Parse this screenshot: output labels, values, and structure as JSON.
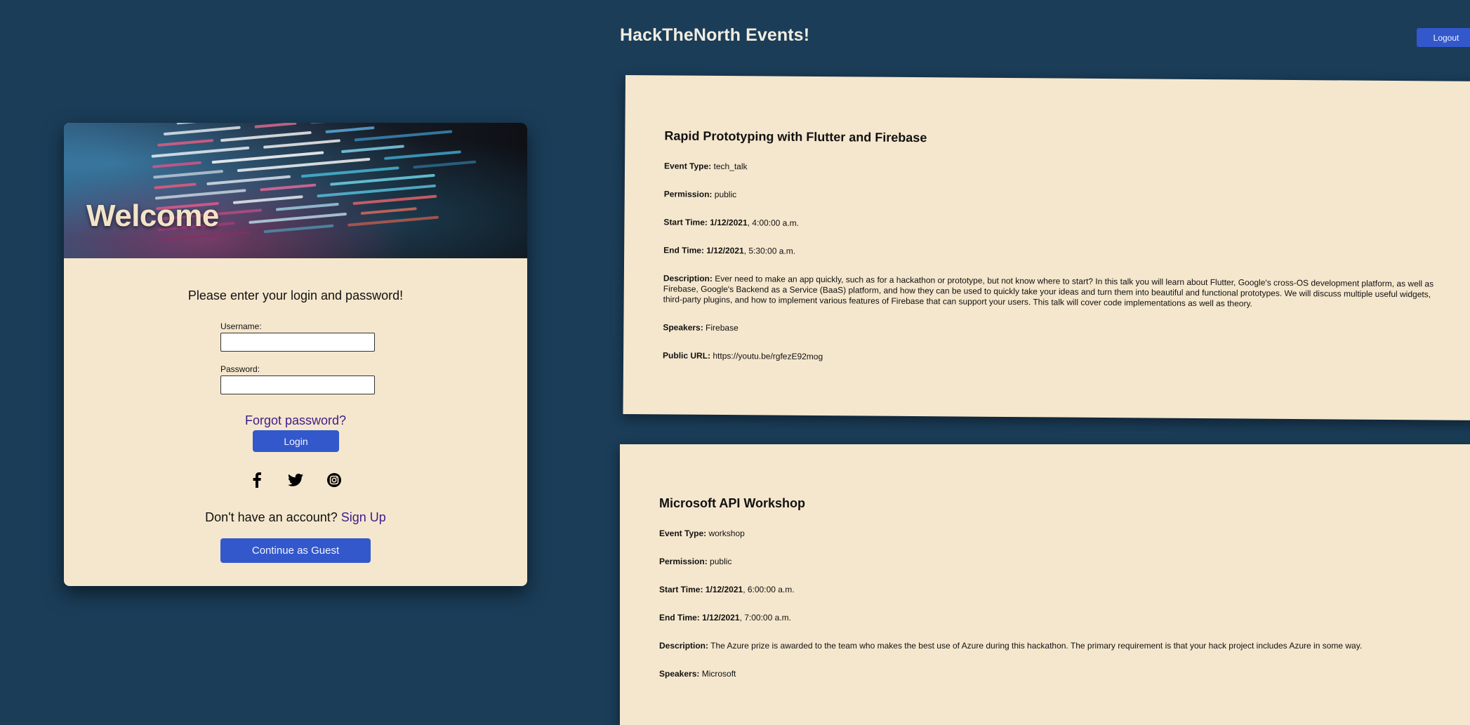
{
  "header": {
    "title": "HackTheNorth Events!",
    "logout_label": "Logout"
  },
  "login": {
    "welcome": "Welcome",
    "prompt": "Please enter your login and password!",
    "username_label": "Username:",
    "username_value": "",
    "password_label": "Password:",
    "password_value": "",
    "forgot_label": "Forgot password?",
    "login_label": "Login",
    "social": [
      "facebook-icon",
      "twitter-icon",
      "instagram-icon"
    ],
    "signup_prompt": "Don't have an account?",
    "signup_label": "Sign Up",
    "guest_label": "Continue as Guest"
  },
  "labels": {
    "event_type": "Event Type:",
    "permission": "Permission:",
    "start_time": "Start Time:",
    "end_time": "End Time:",
    "description": "Description:",
    "speakers": "Speakers:",
    "public_url": "Public URL:"
  },
  "events": [
    {
      "name": "Rapid Prototyping with Flutter and Firebase",
      "event_type": "tech_talk",
      "permission": "public",
      "start_date": "1/12/2021",
      "start_time": "4:00:00 a.m.",
      "end_date": "1/12/2021",
      "end_time": "5:30:00 a.m.",
      "description": "Ever need to make an app quickly, such as for a hackathon or prototype, but not know where to start? In this talk you will learn about Flutter, Google's cross-OS development platform, as well as Firebase, Google's Backend as a Service (BaaS) platform, and how they can be used to quickly take your ideas and turn them into beautiful and functional prototypes. We will discuss multiple useful widgets, third-party plugins, and how to implement various features of Firebase that can support your users. This talk will cover code implementations as well as theory.",
      "speakers": "Firebase",
      "public_url": "https://youtu.be/rgfezE92mog"
    },
    {
      "name": "Microsoft API Workshop",
      "event_type": "workshop",
      "permission": "public",
      "start_date": "1/12/2021",
      "start_time": "6:00:00 a.m.",
      "end_date": "1/12/2021",
      "end_time": "7:00:00 a.m.",
      "description": "The Azure prize is awarded to the team who makes the best use of Azure during this hackathon. The primary requirement is that your hack project includes Azure in some way.",
      "speakers": "Microsoft"
    }
  ],
  "colors": {
    "background": "#1b3d58",
    "card": "#f5e7cd",
    "button": "#3358cb",
    "link": "#3d1c8a"
  }
}
